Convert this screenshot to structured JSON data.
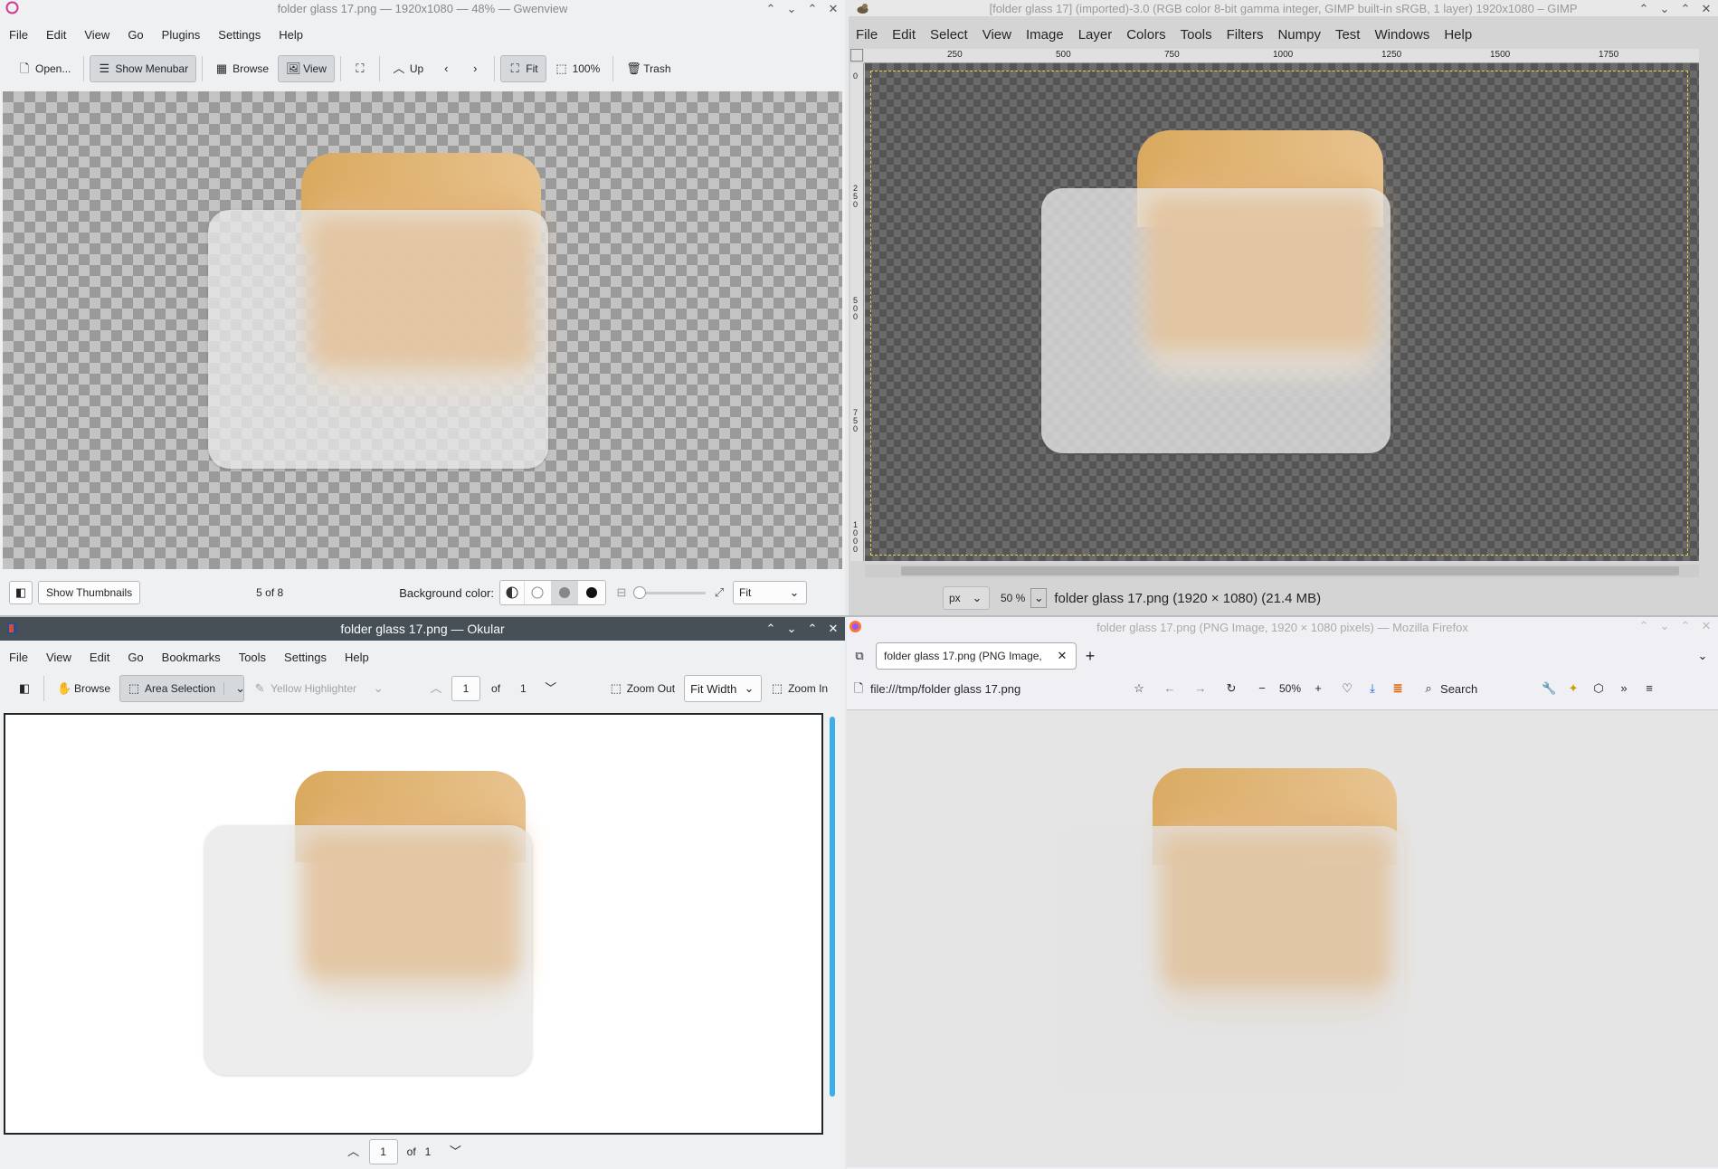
{
  "gwenview": {
    "title": "folder glass 17.png — 1920x1080 — 48% — Gwenview",
    "menu": [
      "File",
      "Edit",
      "View",
      "Go",
      "Plugins",
      "Settings",
      "Help"
    ],
    "toolbar": {
      "open": "Open...",
      "show_menubar": "Show Menubar",
      "browse": "Browse",
      "view": "View",
      "up": "Up",
      "fit": "Fit",
      "zoom100": "100%",
      "trash": "Trash"
    },
    "statusbar": {
      "show_thumbnails": "Show Thumbnails",
      "position": "5 of 8",
      "background_label": "Background color:",
      "zoom_mode": "Fit"
    }
  },
  "gimp": {
    "title": "[folder glass 17] (imported)-3.0 (RGB color 8-bit gamma integer, GIMP built-in sRGB, 1 layer) 1920x1080 – GIMP",
    "menu": [
      "File",
      "Edit",
      "Select",
      "View",
      "Image",
      "Layer",
      "Colors",
      "Tools",
      "Filters",
      "Numpy",
      "Test",
      "Windows",
      "Help"
    ],
    "ruler_h": [
      "250",
      "500",
      "750",
      "1000",
      "1250",
      "1500",
      "1750"
    ],
    "ruler_v": [
      "0",
      "250",
      "500",
      "750",
      "1000"
    ],
    "status": {
      "unit": "px",
      "zoom": "50 %",
      "info": "folder glass 17.png (1920 × 1080) (21.4 MB)"
    }
  },
  "okular": {
    "title": "folder glass 17.png — Okular",
    "menu": [
      "File",
      "View",
      "Edit",
      "Go",
      "Bookmarks",
      "Tools",
      "Settings",
      "Help"
    ],
    "toolbar": {
      "browse": "Browse",
      "area_selection": "Area Selection",
      "highlighter": "Yellow Highlighter",
      "page": "1",
      "of": "of",
      "total": "1",
      "zoom_out": "Zoom Out",
      "fit_width": "Fit Width",
      "zoom_in": "Zoom In"
    },
    "bottom": {
      "page": "1",
      "of": "of",
      "total": "1"
    }
  },
  "firefox": {
    "title": "folder glass 17.png (PNG Image, 1920 × 1080 pixels) — Mozilla Firefox",
    "tab_label": "folder glass 17.png (PNG Image,",
    "url": "file:///tmp/folder glass 17.png",
    "zoom": "50%",
    "search_placeholder": "Search"
  }
}
